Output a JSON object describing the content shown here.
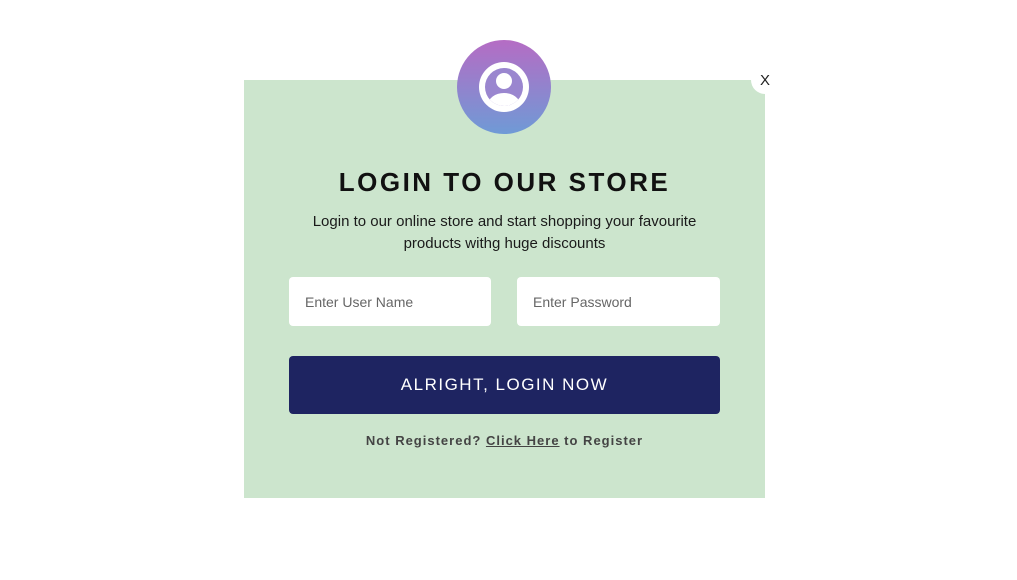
{
  "modal": {
    "close_label": "X",
    "title": "LOGIN TO OUR STORE",
    "subtitle": "Login to our online store and start shopping your favourite products withg huge discounts",
    "avatar_icon": "user-circle-icon",
    "avatar_gradient": [
      "#b56cc4",
      "#6f9ad6"
    ],
    "background_color": "#cce5cd"
  },
  "form": {
    "username_placeholder": "Enter User Name",
    "username_value": "",
    "password_placeholder": "Enter Password",
    "password_value": "",
    "submit_label": "ALRIGHT, LOGIN NOW",
    "submit_color": "#1e2461"
  },
  "register": {
    "prefix": "Not Registered?",
    "link_label": "Click Here",
    "suffix": "to Register"
  }
}
